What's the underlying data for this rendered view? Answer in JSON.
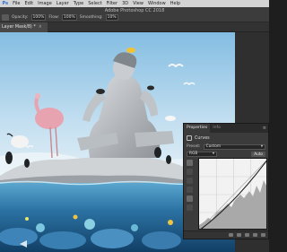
{
  "menu": [
    "Ps",
    "File",
    "Edit",
    "Image",
    "Layer",
    "Type",
    "Select",
    "Filter",
    "3D",
    "View",
    "Window",
    "Help"
  ],
  "app_title": "Adobe Photoshop CC 2018",
  "options": {
    "opacity_label": "Opacity:",
    "opacity_value": "100%",
    "flow_label": "Flow:",
    "flow_value": "100%",
    "smoothing_label": "Smoothing:",
    "smoothing_value": "10%"
  },
  "document_tab": {
    "label": "Layer Mask/8) *",
    "close": "×"
  },
  "properties": {
    "tabs": [
      "Properties",
      "Info"
    ],
    "menu_glyph": "≡",
    "adjustment_label": "Curves",
    "preset_label": "Preset:",
    "preset_value": "Custom",
    "channel_value": "RGB",
    "auto_label": "Auto"
  },
  "colors": {
    "sky_top": "#8fc3e4",
    "sky_bottom": "#d8ebf5",
    "water": "#2a6f9e",
    "panel": "#3b3b3b",
    "accent_flamingo": "#e8a3b0"
  },
  "icons": [
    "brush-tool-icon",
    "curves-adjustment-icon",
    "eyedropper-icon",
    "pencil-icon",
    "smooth-icon",
    "panel-menu-icon",
    "close-icon"
  ]
}
